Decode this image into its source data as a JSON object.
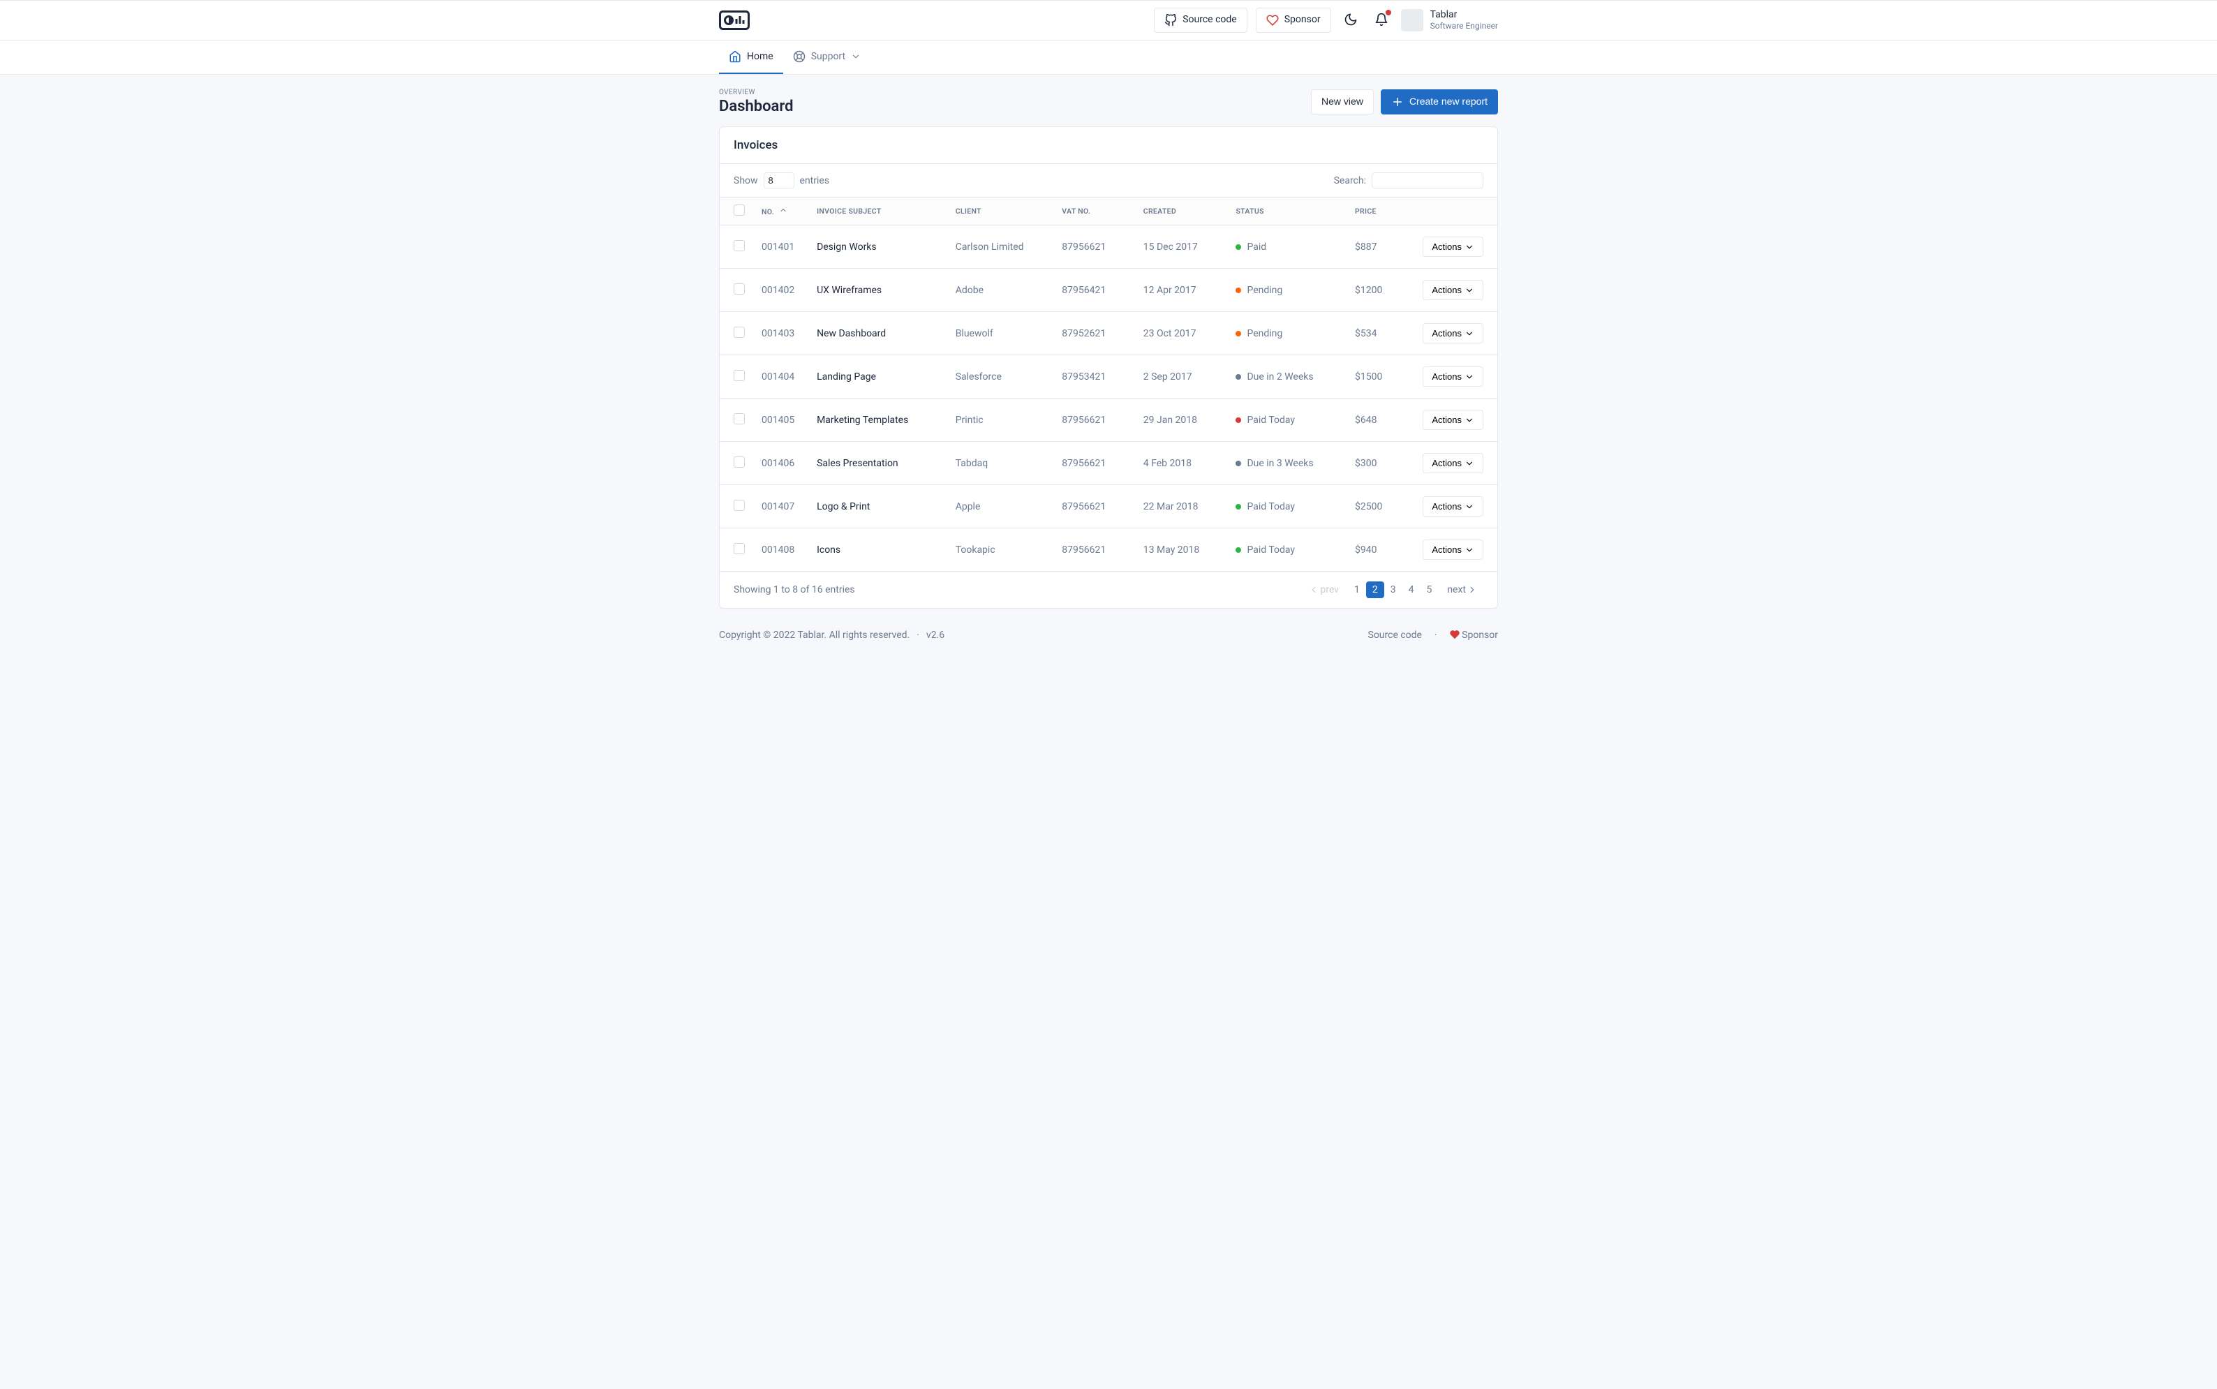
{
  "header": {
    "source_code_label": "Source code",
    "sponsor_label": "Sponsor",
    "user_name": "Tablar",
    "user_role": "Software Engineer"
  },
  "nav": {
    "items": [
      {
        "label": "Home",
        "active": true,
        "icon": "home"
      },
      {
        "label": "Support",
        "active": false,
        "icon": "help"
      }
    ]
  },
  "page": {
    "pretitle": "OVERVIEW",
    "title": "Dashboard",
    "new_view_label": "New view",
    "create_report_label": "Create new report"
  },
  "card": {
    "title": "Invoices",
    "show_label": "Show",
    "show_value": "8",
    "entries_label": "entries",
    "search_label": "Search:",
    "search_value": "",
    "actions_label": "Actions",
    "columns": {
      "no": "No.",
      "subject": "Invoice Subject",
      "client": "Client",
      "vat": "Vat No.",
      "created": "Created",
      "status": "Status",
      "price": "Price"
    },
    "rows": [
      {
        "no": "001401",
        "subject": "Design Works",
        "client": "Carlson Limited",
        "vat": "87956621",
        "created": "15 Dec 2017",
        "status": "Paid",
        "status_color": "green",
        "price": "$887"
      },
      {
        "no": "001402",
        "subject": "UX Wireframes",
        "client": "Adobe",
        "vat": "87956421",
        "created": "12 Apr 2017",
        "status": "Pending",
        "status_color": "orange",
        "price": "$1200"
      },
      {
        "no": "001403",
        "subject": "New Dashboard",
        "client": "Bluewolf",
        "vat": "87952621",
        "created": "23 Oct 2017",
        "status": "Pending",
        "status_color": "orange",
        "price": "$534"
      },
      {
        "no": "001404",
        "subject": "Landing Page",
        "client": "Salesforce",
        "vat": "87953421",
        "created": "2 Sep 2017",
        "status": "Due in 2 Weeks",
        "status_color": "gray",
        "price": "$1500"
      },
      {
        "no": "001405",
        "subject": "Marketing Templates",
        "client": "Printic",
        "vat": "87956621",
        "created": "29 Jan 2018",
        "status": "Paid Today",
        "status_color": "red",
        "price": "$648"
      },
      {
        "no": "001406",
        "subject": "Sales Presentation",
        "client": "Tabdaq",
        "vat": "87956621",
        "created": "4 Feb 2018",
        "status": "Due in 3 Weeks",
        "status_color": "gray",
        "price": "$300"
      },
      {
        "no": "001407",
        "subject": "Logo & Print",
        "client": "Apple",
        "vat": "87956621",
        "created": "22 Mar 2018",
        "status": "Paid Today",
        "status_color": "green",
        "price": "$2500"
      },
      {
        "no": "001408",
        "subject": "Icons",
        "client": "Tookapic",
        "vat": "87956621",
        "created": "13 May 2018",
        "status": "Paid Today",
        "status_color": "green",
        "price": "$940"
      }
    ],
    "footer_text": "Showing 1 to 8 of 16 entries",
    "pagination": {
      "prev_label": "prev",
      "next_label": "next",
      "pages": [
        "1",
        "2",
        "3",
        "4",
        "5"
      ],
      "active_index": 1
    }
  },
  "footer": {
    "copyright": "Copyright © 2022 Tablar. All rights reserved.",
    "version": "v2.6",
    "source_code_label": "Source code",
    "sponsor_label": "Sponsor"
  }
}
